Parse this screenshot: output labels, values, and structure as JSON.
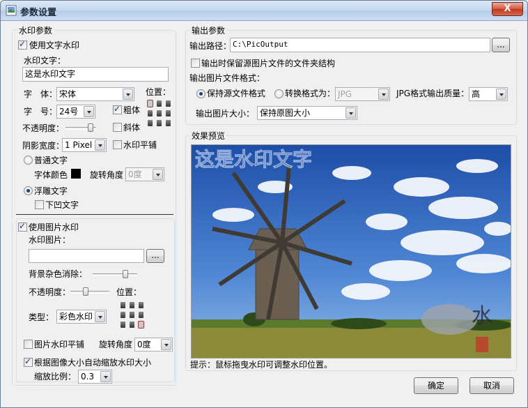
{
  "window": {
    "title": "参数设置",
    "close_label": "X"
  },
  "watermark_params": {
    "group_label": "水印参数",
    "use_text_label": "使用文字水印",
    "text_label": "水印文字：",
    "text_value": "这是水印文字",
    "font_label": "字　体：",
    "font_value": "宋体",
    "size_label": "字　号：",
    "size_value": "24号",
    "bold_label": "粗体",
    "italic_label": "斜体",
    "position_label": "位置：",
    "opacity_label": "不透明度：",
    "shadow_label": "阴影宽度：",
    "shadow_value": "1 Pixel",
    "tile_label": "水印平铺",
    "normal_text_label": "普通文字",
    "font_color_label": "字体颜色",
    "rotate_label": "旋转角度",
    "rotate_value": "0度",
    "emboss_label": "浮雕文字",
    "sunken_label": "下凹文字",
    "use_image_label": "使用图片水印",
    "image_label": "水印图片：",
    "image_path": "",
    "browse_label": "...",
    "bg_remove_label": "背景杂色消除：",
    "img_opacity_label": "不透明度：",
    "img_position_label": "位置：",
    "type_label": "类型：",
    "type_value": "彩色水印",
    "img_tile_label": "图片水印平铺",
    "img_rotate_label": "旋转角度",
    "img_rotate_value": "0度",
    "auto_scale_label": "根据图像大小自动缩放水印大小",
    "scale_label": "缩放比例：",
    "scale_value": "0.3"
  },
  "output_params": {
    "group_label": "输出参数",
    "path_label": "输出路径：",
    "path_value": "C:\\PicOutput",
    "browse_label": "...",
    "keep_structure_label": "输出时保留源图片文件的文件夹结构",
    "format_label": "输出图片文件格式：",
    "keep_format_label": "保持源文件格式",
    "convert_label": "转换格式为：",
    "convert_value": "JPG",
    "jpg_quality_label": "JPG格式输出质量：",
    "jpg_quality_value": "高",
    "size_label": "输出图片大小：",
    "size_value": "保持原图大小"
  },
  "preview": {
    "group_label": "效果预览",
    "watermark_text": "这是水印文字",
    "hint": "提示：鼠标拖曳水印可调整水印位置。"
  },
  "buttons": {
    "ok": "确定",
    "cancel": "取消"
  },
  "colors": {
    "font_color": "#000000",
    "sky": "#3a6fc4",
    "title_bar": "#c3d7ef"
  }
}
